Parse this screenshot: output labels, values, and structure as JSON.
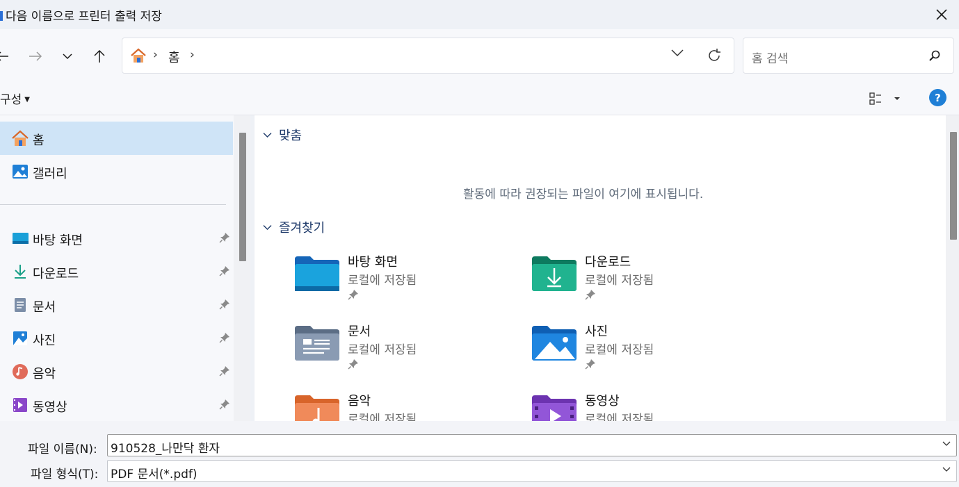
{
  "window": {
    "title": "다음 이름으로 프린터 출력 저장"
  },
  "address_bar": {
    "crumb": "홈",
    "separator": "›"
  },
  "search": {
    "placeholder": "홈 검색"
  },
  "toolbar": {
    "organize_label": "구성",
    "help_label": "?"
  },
  "sidebar": {
    "items": [
      {
        "label": "홈",
        "icon": "home-icon",
        "active": true,
        "pinned": false
      },
      {
        "label": "갤러리",
        "icon": "gallery-icon",
        "active": false,
        "pinned": false
      },
      {
        "label": "바탕 화면",
        "icon": "desktop-icon",
        "active": false,
        "pinned": true
      },
      {
        "label": "다운로드",
        "icon": "download-icon",
        "active": false,
        "pinned": true
      },
      {
        "label": "문서",
        "icon": "documents-icon",
        "active": false,
        "pinned": true
      },
      {
        "label": "사진",
        "icon": "pictures-icon",
        "active": false,
        "pinned": true
      },
      {
        "label": "음악",
        "icon": "music-icon",
        "active": false,
        "pinned": true
      },
      {
        "label": "동영상",
        "icon": "videos-icon",
        "active": false,
        "pinned": true
      }
    ]
  },
  "main": {
    "recommended": {
      "header": "맞춤",
      "empty_message": "활동에 따라 권장되는 파일이 여기에 표시됩니다."
    },
    "favorites": {
      "header": "즐겨찾기",
      "items": [
        {
          "name": "바탕 화면",
          "subtitle": "로컬에 저장됨",
          "icon": "desktop-folder-icon"
        },
        {
          "name": "다운로드",
          "subtitle": "로컬에 저장됨",
          "icon": "downloads-folder-icon"
        },
        {
          "name": "문서",
          "subtitle": "로컬에 저장됨",
          "icon": "documents-folder-icon"
        },
        {
          "name": "사진",
          "subtitle": "로컬에 저장됨",
          "icon": "pictures-folder-icon"
        },
        {
          "name": "음악",
          "subtitle": "로컬에 저장됨",
          "icon": "music-folder-icon"
        },
        {
          "name": "동영상",
          "subtitle": "로컬에 저장됨",
          "icon": "videos-folder-icon"
        }
      ]
    }
  },
  "save_form": {
    "filename_label": "파일 이름(N):",
    "filename_value": "910528_나만닥 환자",
    "filetype_label": "파일 형식(T):",
    "filetype_value": "PDF 문서(*.pdf)"
  },
  "colors": {
    "accent": "#1f7fd6",
    "selected_bg": "#cfe4f7",
    "window_bg": "#eef1f6"
  }
}
